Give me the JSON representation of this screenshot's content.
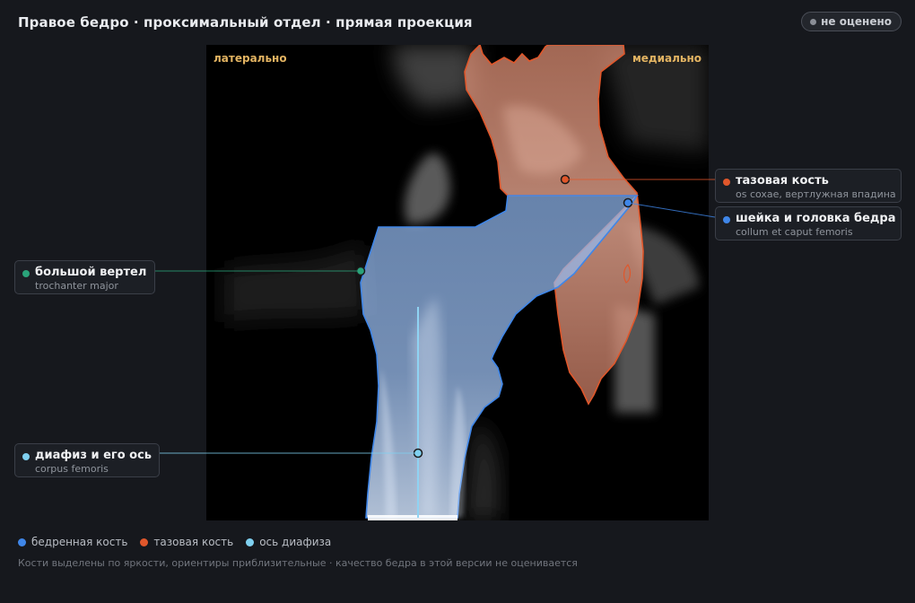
{
  "header": {
    "title": "Правое бедро · проксимальный отдел · прямая проекция",
    "status_badge": "не оценено"
  },
  "viewer": {
    "label_left": "латерально",
    "label_right": "медиально"
  },
  "callouts": {
    "pelvis": {
      "name": "тазовая кость",
      "latin": "os coxae, вертлужная впадина",
      "color": "#e0572b"
    },
    "neck": {
      "name": "шейка и головка бедра",
      "latin": "collum et caput femoris",
      "color": "#3f86e8"
    },
    "trochanter": {
      "name": "большой вертел",
      "latin": "trochanter major",
      "color": "#2aa37a"
    },
    "shaft": {
      "name": "диафиз и его ось",
      "latin": "corpus femoris",
      "color": "#7fd0f0"
    }
  },
  "legend": [
    {
      "label": "бедренная кость",
      "color": "#3f86e8"
    },
    {
      "label": "тазовая кость",
      "color": "#e0572b"
    },
    {
      "label": "ось диафиза",
      "color": "#7fd0f0"
    }
  ],
  "footer_note": "Кости выделены по яркости, ориентиры приблизительные · качество бедра в этой версии не оценивается"
}
